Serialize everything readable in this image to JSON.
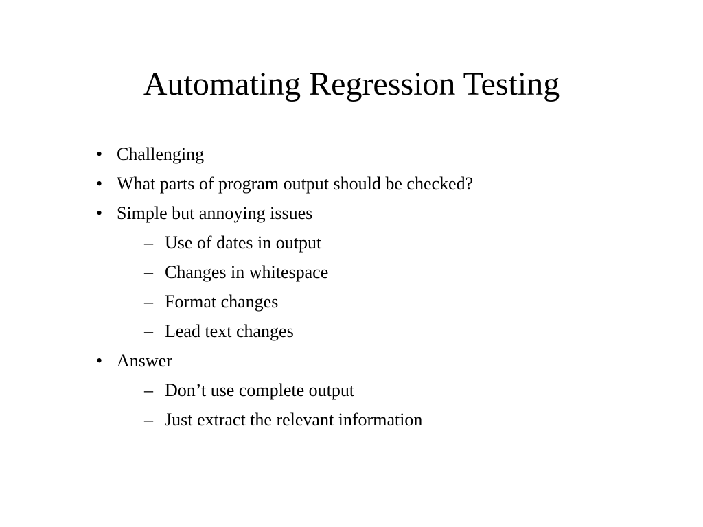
{
  "title": "Automating Regression Testing",
  "bullets": {
    "b0": "Challenging",
    "b1": "What parts of program output should be checked?",
    "b2": "Simple but annoying issues",
    "b2_sub": {
      "s0": "Use of dates in output",
      "s1": "Changes in whitespace",
      "s2": "Format changes",
      "s3": "Lead text changes"
    },
    "b3": "Answer",
    "b3_sub": {
      "s0": "Don’t use complete output",
      "s1": "Just extract the relevant information"
    }
  }
}
